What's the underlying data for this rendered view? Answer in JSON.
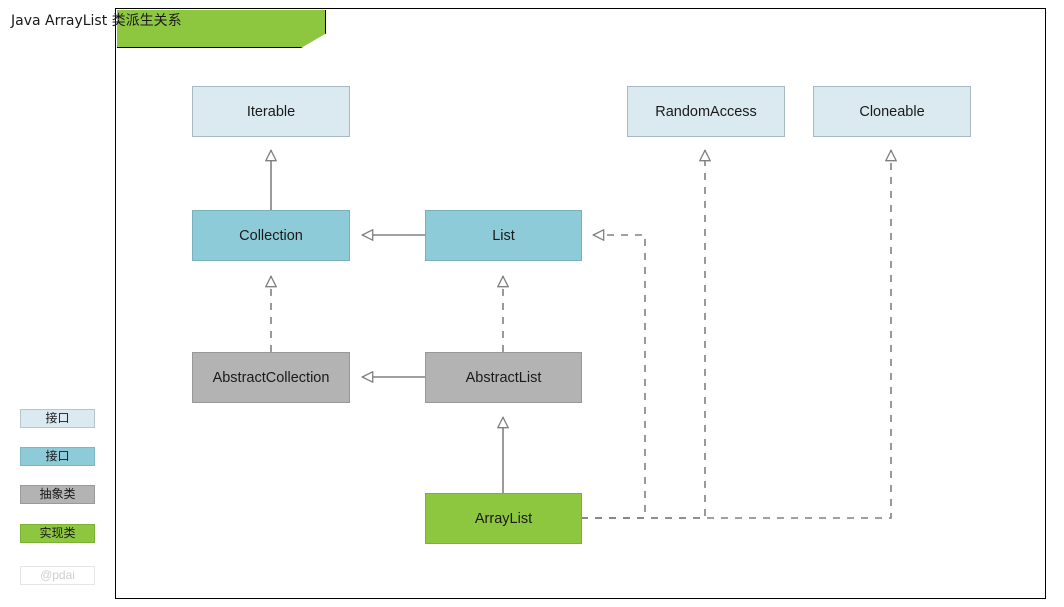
{
  "diagram": {
    "title": "Java ArrayList 类派生关系",
    "border_color": "#000000",
    "background": "#ffffff"
  },
  "legend": {
    "items": [
      {
        "label": "接口",
        "color": "#dbeaf1",
        "name": "legend-interface-light"
      },
      {
        "label": "接口",
        "color": "#8ecbd9",
        "name": "legend-interface-dark"
      },
      {
        "label": "抽象类",
        "color": "#b3b3b3",
        "name": "legend-abstract-class"
      },
      {
        "label": "实现类",
        "color": "#8dc63f",
        "name": "legend-concrete-class"
      },
      {
        "label": "@pdai",
        "color": "#ffffff",
        "name": "legend-watermark"
      }
    ]
  },
  "nodes": {
    "iterable": {
      "label": "Iterable",
      "type": "interface",
      "color": "#dbeaf1"
    },
    "random_access": {
      "label": "RandomAccess",
      "type": "interface",
      "color": "#dbeaf1"
    },
    "cloneable": {
      "label": "Cloneable",
      "type": "interface",
      "color": "#dbeaf1"
    },
    "collection": {
      "label": "Collection",
      "type": "interface",
      "color": "#8ecbd9"
    },
    "list": {
      "label": "List",
      "type": "interface",
      "color": "#8ecbd9"
    },
    "abstract_collection": {
      "label": "AbstractCollection",
      "type": "abstract-class",
      "color": "#b3b3b3"
    },
    "abstract_list": {
      "label": "AbstractList",
      "type": "abstract-class",
      "color": "#b3b3b3"
    },
    "array_list": {
      "label": "ArrayList",
      "type": "concrete-class",
      "color": "#8dc63f"
    }
  },
  "edges": [
    {
      "from": "Collection",
      "to": "Iterable",
      "style": "solid",
      "arrow": "hollow-triangle"
    },
    {
      "from": "List",
      "to": "Collection",
      "style": "solid",
      "arrow": "hollow-triangle"
    },
    {
      "from": "AbstractCollection",
      "to": "Collection",
      "style": "dashed",
      "arrow": "hollow-triangle"
    },
    {
      "from": "AbstractList",
      "to": "List",
      "style": "dashed",
      "arrow": "hollow-triangle"
    },
    {
      "from": "AbstractList",
      "to": "AbstractCollection",
      "style": "solid",
      "arrow": "hollow-triangle"
    },
    {
      "from": "ArrayList",
      "to": "AbstractList",
      "style": "solid",
      "arrow": "hollow-triangle"
    },
    {
      "from": "ArrayList",
      "to": "List",
      "style": "dashed",
      "arrow": "hollow-triangle"
    },
    {
      "from": "ArrayList",
      "to": "RandomAccess",
      "style": "dashed",
      "arrow": "hollow-triangle"
    },
    {
      "from": "ArrayList",
      "to": "Cloneable",
      "style": "dashed",
      "arrow": "hollow-triangle"
    }
  ],
  "edge_color": "#808080"
}
